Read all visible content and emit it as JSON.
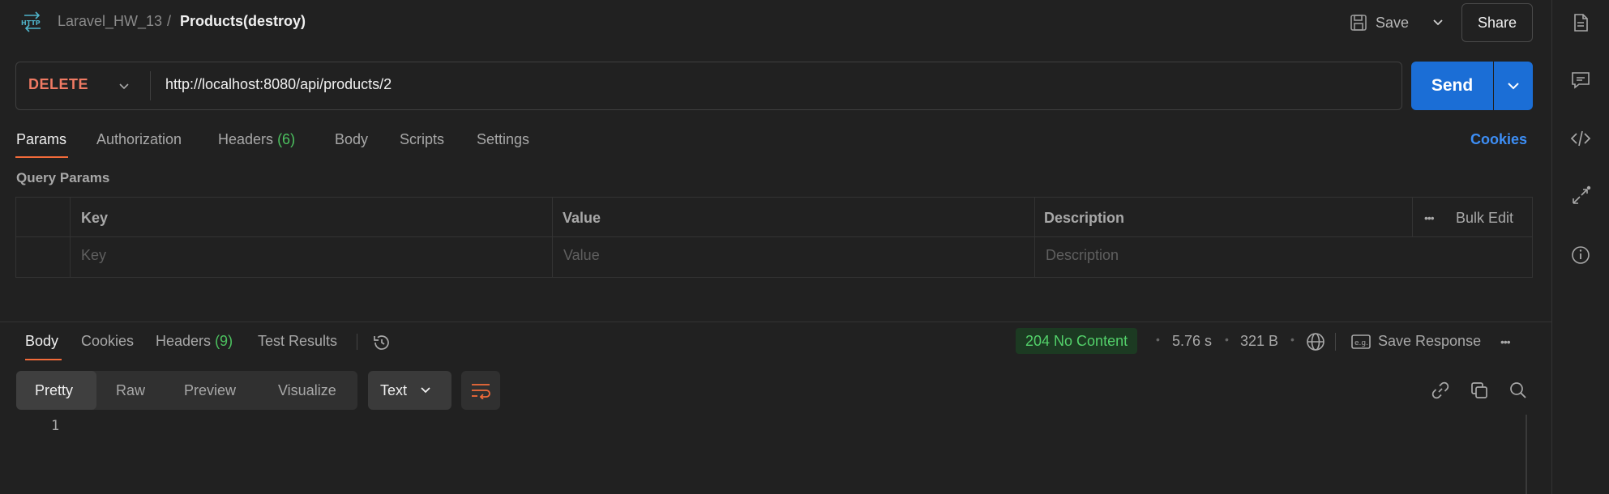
{
  "header": {
    "breadcrumb_parent": "Laravel_HW_13",
    "breadcrumb_separator": "/",
    "breadcrumb_current": "Products(destroy)",
    "save_label": "Save",
    "share_label": "Share",
    "http_icon": "http-icon"
  },
  "request": {
    "method": "DELETE",
    "url": "http://localhost:8080/api/products/2",
    "send_label": "Send"
  },
  "request_tabs": {
    "params": "Params",
    "authorization": "Authorization",
    "headers": "Headers",
    "headers_count": "(6)",
    "body": "Body",
    "scripts": "Scripts",
    "settings": "Settings",
    "cookies": "Cookies"
  },
  "query_params": {
    "title": "Query Params",
    "columns": [
      "Key",
      "Value",
      "Description"
    ],
    "bulk_edit": "Bulk Edit",
    "placeholders": {
      "key": "Key",
      "value": "Value",
      "description": "Description"
    }
  },
  "response": {
    "tabs": {
      "body": "Body",
      "cookies": "Cookies",
      "headers": "Headers",
      "headers_count": "(9)",
      "test_results": "Test Results"
    },
    "status": "204 No Content",
    "time": "5.76 s",
    "size": "321 B",
    "save_response": "Save Response",
    "views": [
      "Pretty",
      "Raw",
      "Preview",
      "Visualize"
    ],
    "format": "Text",
    "line_numbers": [
      "1"
    ]
  },
  "colors": {
    "accent": "#f26b3a",
    "method_delete": "#f07a63",
    "send": "#1b6ed6",
    "link": "#3d8ef5",
    "success": "#53d16a"
  },
  "sidebar_icons": [
    "document-icon",
    "comment-icon",
    "code-icon",
    "related-icon",
    "info-icon"
  ]
}
